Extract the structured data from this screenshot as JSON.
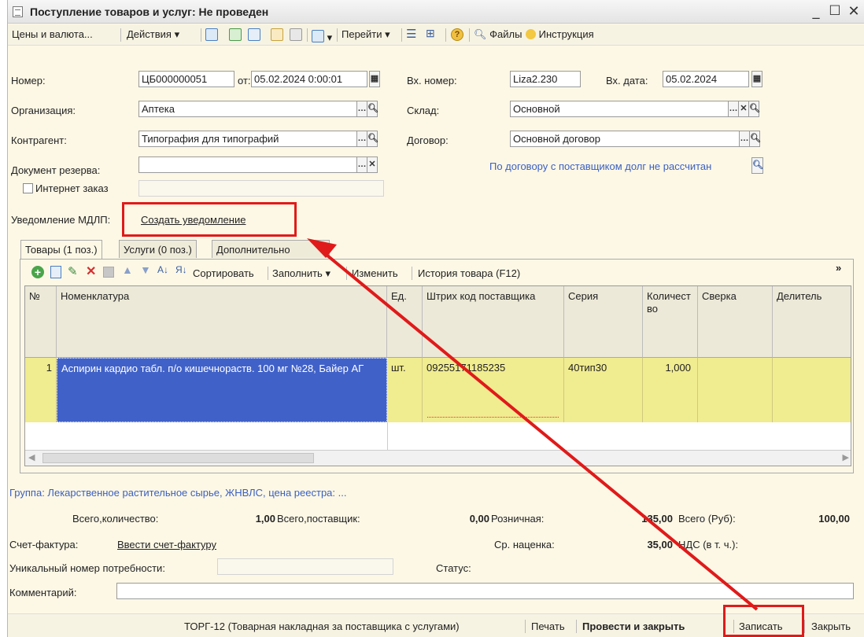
{
  "window": {
    "title": "Поступление товаров и услуг: Не проведен"
  },
  "toolbar": {
    "prices": "Цены и валюта...",
    "actions": "Действия",
    "goto": "Перейти",
    "files": "Файлы",
    "instructions": "Инструкция"
  },
  "header": {
    "number_label": "Номер:",
    "number": "ЦБ000000051",
    "from_label": "от:",
    "date": "05.02.2024 0:00:01",
    "org_label": "Организация:",
    "org": "Аптека",
    "contractor_label": "Контрагент:",
    "contractor": "Типография для типографий",
    "reserve_label": "Документ резерва:",
    "reserve": "",
    "internet_order": "Интернет заказ",
    "in_number_label": "Вх. номер:",
    "in_number": "Liza2.230",
    "in_date_label": "Вх. дата:",
    "in_date": "05.02.2024",
    "warehouse_label": "Склад:",
    "warehouse": "Основной",
    "contract_label": "Договор:",
    "contract": "Основной договор",
    "debt_note": "По договору с поставщиком долг не рассчитан",
    "mdlp_label": "Уведомление МДЛП:",
    "mdlp_link": "Создать уведомление"
  },
  "tabs": [
    "Товары (1 поз.)",
    "Услуги (0 поз.)",
    "Дополнительно"
  ],
  "grid_toolbar": {
    "sort": "Сортировать",
    "fill": "Заполнить",
    "change": "Изменить",
    "history": "История товара (F12)"
  },
  "grid": {
    "columns": [
      "№",
      "Номенклатура",
      "Ед.",
      "Штрих код поставщика",
      "Серия",
      "Количество",
      "Сверка",
      "Делитель"
    ],
    "rows": [
      {
        "n": "1",
        "name": "Аспирин кардио табл. п/о кишечнораств. 100 мг №28, Байер АГ",
        "unit": "шт.",
        "barcode": "09255171185235",
        "series": "40тип30",
        "qty": "1,000",
        "check": ""
      }
    ]
  },
  "group_line": "Группа: Лекарственное растительное сырье, ЖНВЛС, цена реестра: ...",
  "totals": {
    "qty_label": "Всего,количество:",
    "qty": "1,00",
    "supplier_label": "Всего,поставщик:",
    "supplier": "0,00",
    "retail_label": "Розничная:",
    "retail": "135,00",
    "total_label": "Всего (Руб):",
    "total": "100,00",
    "markup_label": "Ср. наценка:",
    "markup": "35,00",
    "vat_label": "НДС (в т. ч.):",
    "vat": ""
  },
  "invoice_label": "Счет-фактура:",
  "invoice_link": "Ввести счет-фактуру",
  "need_label": "Уникальный номер потребности:",
  "status_label": "Статус:",
  "comment_label": "Комментарий:",
  "bottom": {
    "torg": "ТОРГ-12 (Товарная накладная за поставщика с услугами)",
    "print": "Печать",
    "post_close": "Провести и закрыть",
    "save": "Записать",
    "close": "Закрыть"
  },
  "colors": {
    "annotation": "#e01a1a",
    "selected_row": "#4061c8",
    "row_highlight": "#f0ec90"
  }
}
